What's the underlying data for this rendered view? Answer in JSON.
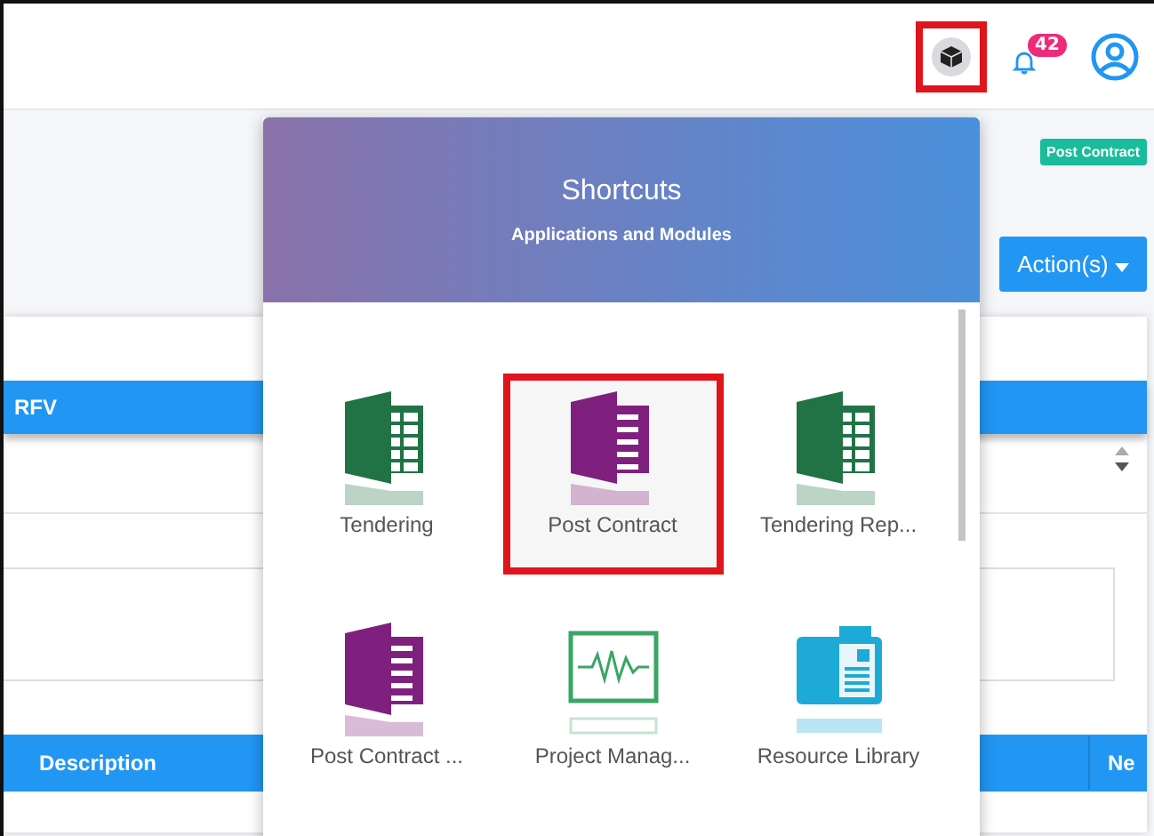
{
  "topbar": {
    "apps_button": {
      "highlighted": true
    },
    "notifications": {
      "count": "42"
    }
  },
  "page": {
    "status_badge": "Post Contract",
    "action_button": "Action(s)",
    "table_header": "RFV",
    "second_header": {
      "columns": [
        "Description",
        "Ne"
      ]
    }
  },
  "shortcuts": {
    "title": "Shortcuts",
    "subtitle": "Applications and Modules",
    "items": [
      {
        "label": "Tendering",
        "kind": "workbook",
        "color": "#217346",
        "highlighted": false
      },
      {
        "label": "Post Contract",
        "kind": "document",
        "color": "#80207e",
        "highlighted": true
      },
      {
        "label": "Tendering Rep...",
        "kind": "workbook",
        "color": "#217346",
        "highlighted": false
      },
      {
        "label": "Post Contract ...",
        "kind": "document",
        "color": "#80207e",
        "highlighted": false
      },
      {
        "label": "Project Manag...",
        "kind": "monitor",
        "color": "#3aa564",
        "highlighted": false
      },
      {
        "label": "Resource Library",
        "kind": "library",
        "color": "#1eaad6",
        "highlighted": false
      }
    ]
  }
}
